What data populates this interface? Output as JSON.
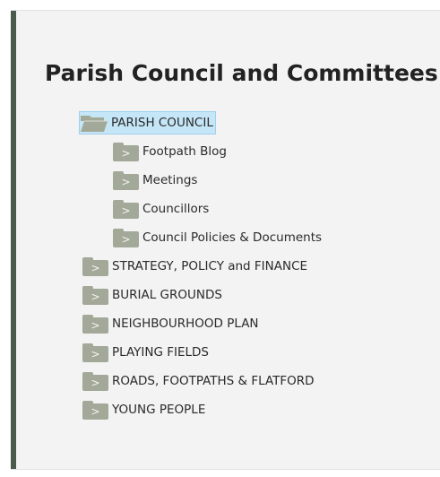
{
  "page": {
    "title": "Parish Council and Committees"
  },
  "tree": {
    "root": {
      "label": "PARISH COUNCIL",
      "children": [
        {
          "label": "Footpath Blog",
          "toggle": ">"
        },
        {
          "label": "Meetings",
          "toggle": ">"
        },
        {
          "label": "Councillors",
          "toggle": ">"
        },
        {
          "label": "Council Policies & Documents",
          "toggle": ">"
        }
      ]
    },
    "siblings": [
      {
        "label": "STRATEGY, POLICY and FINANCE",
        "toggle": ">"
      },
      {
        "label": "BURIAL GROUNDS",
        "toggle": ">"
      },
      {
        "label": "NEIGHBOURHOOD PLAN",
        "toggle": ">"
      },
      {
        "label": "PLAYING FIELDS",
        "toggle": ">"
      },
      {
        "label": "ROADS, FOOTPATHS & FLATFORD",
        "toggle": ">"
      },
      {
        "label": "YOUNG PEOPLE",
        "toggle": ">"
      }
    ]
  },
  "colors": {
    "panel_bg": "#f3f3f3",
    "accent_bar": "#4a5a4c",
    "folder": "#a2a998",
    "selected_bg": "#c5e6f7"
  },
  "icons": {
    "open": "folder-open-icon",
    "closed": "folder-closed-icon"
  }
}
